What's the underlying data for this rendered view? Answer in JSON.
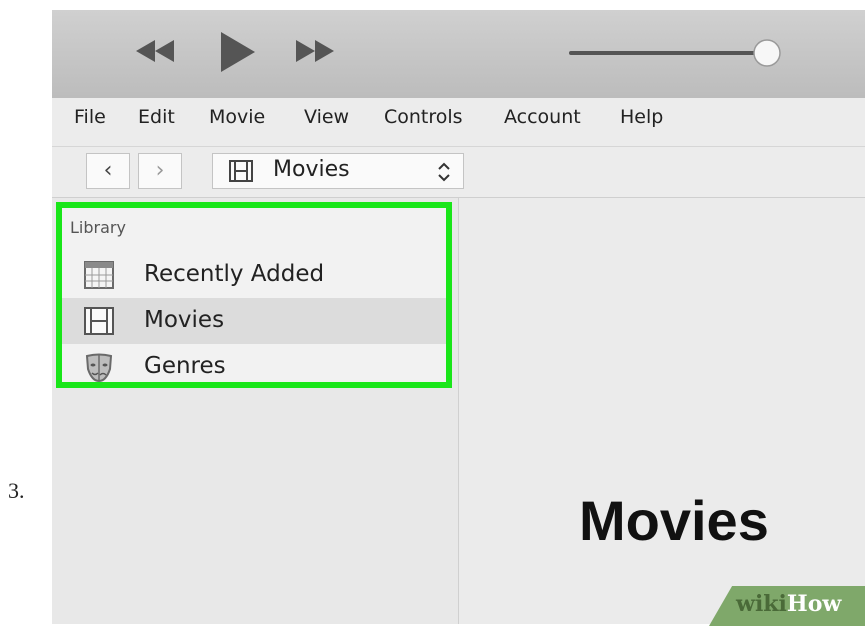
{
  "step_number": "3.",
  "menubar": {
    "items": [
      "File",
      "Edit",
      "Movie",
      "View",
      "Controls",
      "Account",
      "Help"
    ]
  },
  "navbar": {
    "back_glyph": "‹",
    "forward_glyph": "›",
    "source_selector": {
      "value": "Movies",
      "icon": "film-icon",
      "indicator": "up-down-chevron-icon"
    }
  },
  "sidebar": {
    "section_header": "Library",
    "items": [
      {
        "label": "Recently Added",
        "icon": "calendar-grid-icon",
        "selected": false
      },
      {
        "label": "Movies",
        "icon": "film-icon",
        "selected": true
      },
      {
        "label": "Genres",
        "icon": "theater-mask-icon",
        "selected": false
      }
    ],
    "highlight_color": "#19e619"
  },
  "content": {
    "title": "Movies"
  },
  "watermark": {
    "part1": "wiki",
    "part2": "How"
  }
}
